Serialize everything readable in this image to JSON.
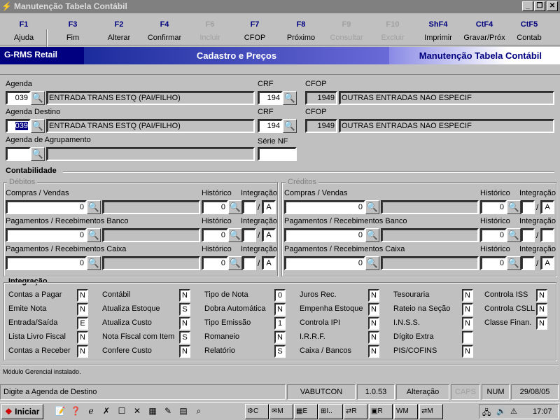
{
  "window": {
    "title": "Manutenção Tabela Contábil",
    "minimize": "_",
    "maximize": "❐",
    "close": "✕"
  },
  "fkeys": [
    {
      "key": "F1",
      "label": "Ajuda",
      "enabled": true
    },
    {
      "key": "F3",
      "label": "Fim",
      "enabled": true
    },
    {
      "key": "F2",
      "label": "Alterar",
      "enabled": true
    },
    {
      "key": "F4",
      "label": "Confirmar",
      "enabled": true
    },
    {
      "key": "F6",
      "label": "Incluir",
      "enabled": false
    },
    {
      "key": "F7",
      "label": "CFOP",
      "enabled": true
    },
    {
      "key": "F8",
      "label": "Próximo",
      "enabled": true
    },
    {
      "key": "F9",
      "label": "Consultar",
      "enabled": false
    },
    {
      "key": "F10",
      "label": "Excluir",
      "enabled": false
    },
    {
      "key": "ShF4",
      "label": "Imprimir",
      "enabled": true
    },
    {
      "key": "CtF4",
      "label": "Gravar/Próx",
      "enabled": true
    },
    {
      "key": "CtF5",
      "label": "Contab",
      "enabled": true
    }
  ],
  "band": {
    "left": "G-RMS Retail",
    "middle": "Cadastro e Preços",
    "right": "Manutenção Tabela Contábil"
  },
  "form": {
    "agenda_label": "Agenda",
    "agenda_code": "039",
    "agenda_desc": "ENTRADA TRANS ESTQ (PAI/FILHO)",
    "crf_label": "CRF",
    "crf1": "194",
    "cfop_label": "CFOP",
    "cfop1_code": "1949",
    "cfop1_desc": "OUTRAS ENTRADAS NAO ESPECIF",
    "agenda_destino_label": "Agenda Destino",
    "agenda_destino_code": "039",
    "agenda_destino_desc": "ENTRADA TRANS ESTQ (PAI/FILHO)",
    "crf2": "194",
    "cfop2_code": "1949",
    "cfop2_desc": "OUTRAS ENTRADAS NAO ESPECIF",
    "agrupamento_label": "Agenda de Agrupamento",
    "agrupamento_code": "",
    "agrupamento_desc": "",
    "serie_label": "Série NF",
    "serie_value": ""
  },
  "contabilidade": {
    "title": "Contabilidade",
    "debitos_title": "Débitos",
    "creditos_title": "Créditos",
    "historico_label": "Histórico",
    "integracao_label": "Integração",
    "slash": "/",
    "debitos": [
      {
        "label": "Compras / Vendas",
        "value": "0",
        "historico": "0",
        "integ1": "",
        "integ2": "A"
      },
      {
        "label": "Pagamentos / Recebimentos Banco",
        "value": "0",
        "historico": "0",
        "integ1": "",
        "integ2": "A"
      },
      {
        "label": "Pagamentos / Recebimentos Caixa",
        "value": "0",
        "historico": "0",
        "integ1": "",
        "integ2": "A"
      }
    ],
    "creditos": [
      {
        "label": "Compras / Vendas",
        "value": "0",
        "historico": "0",
        "integ1": "",
        "integ2": "A"
      },
      {
        "label": "Pagamentos / Recebimentos Banco",
        "value": "0",
        "historico": "0",
        "integ1": "",
        "integ2": ""
      },
      {
        "label": "Pagamentos / Recebimentos Caixa",
        "value": "0",
        "historico": "0",
        "integ1": "",
        "integ2": "A"
      }
    ]
  },
  "integracao": {
    "title": "Integração",
    "columns": [
      [
        {
          "label": "Contas a Pagar",
          "value": "N"
        },
        {
          "label": "Emite Nota",
          "value": "N"
        },
        {
          "label": "Entrada/Saída",
          "value": "E"
        },
        {
          "label": "Lista Livro Fiscal",
          "value": "N"
        },
        {
          "label": "Contas a Receber",
          "value": "N"
        }
      ],
      [
        {
          "label": "Contábil",
          "value": "N"
        },
        {
          "label": "Atualiza Estoque",
          "value": "S"
        },
        {
          "label": "Atualiza Custo",
          "value": "N"
        },
        {
          "label": "Nota Fiscal com Item",
          "value": "S"
        },
        {
          "label": "Confere Custo",
          "value": "N"
        }
      ],
      [
        {
          "label": "Tipo de Nota",
          "value": "0"
        },
        {
          "label": "Dobra Automática",
          "value": "N"
        },
        {
          "label": "Tipo Emissão",
          "value": "1"
        },
        {
          "label": "Romaneio",
          "value": "N"
        },
        {
          "label": "Relatório",
          "value": "S"
        }
      ],
      [
        {
          "label": "Juros Rec.",
          "value": "N"
        },
        {
          "label": "Empenha Estoque",
          "value": "N"
        },
        {
          "label": "Controla IPI",
          "value": "N"
        },
        {
          "label": "I.R.R.F.",
          "value": "N"
        },
        {
          "label": "Caixa / Bancos",
          "value": "N"
        }
      ],
      [
        {
          "label": "Tesouraria",
          "value": "N"
        },
        {
          "label": "Rateio na Seção",
          "value": "N"
        },
        {
          "label": "I.N.S.S.",
          "value": "N"
        },
        {
          "label": "Dígito Extra",
          "value": ""
        },
        {
          "label": "PIS/COFINS",
          "value": "N"
        }
      ],
      [
        {
          "label": "Controla ISS",
          "value": "N"
        },
        {
          "label": "Controla CSLL",
          "value": "N"
        },
        {
          "label": "Classe Finan.",
          "value": "N"
        }
      ]
    ]
  },
  "status_line": "Módulo Gerencial instalado.",
  "statusbar": {
    "message": "Digite a Agenda de Destino",
    "user": "VABUTCON",
    "version": "1.0.53",
    "mode": "Alteração",
    "caps": "CAPS",
    "num": "NUM",
    "date": "29/08/05"
  },
  "taskbar": {
    "start": "Iniciar",
    "clock": "17:07",
    "buttons": [
      "C",
      "M",
      "E",
      "I..",
      "R",
      "R",
      "M",
      "M"
    ]
  }
}
